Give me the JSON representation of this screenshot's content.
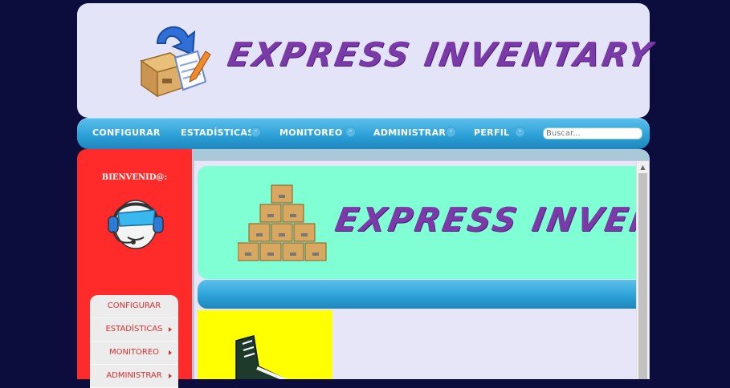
{
  "header": {
    "brand_text": "EXPRESS INVENTARY",
    "logo_icon": "box-with-document-and-arrow-icon"
  },
  "nav": {
    "items": [
      {
        "label": "CONFIGURAR",
        "has_dropdown": false
      },
      {
        "label": "ESTADÍSTICAS",
        "has_dropdown": true
      },
      {
        "label": "MONITOREO",
        "has_dropdown": true
      },
      {
        "label": "ADMINISTRAR",
        "has_dropdown": true
      },
      {
        "label": "PERFIL",
        "has_dropdown": true
      }
    ],
    "dropdown_glyph": "-",
    "search_placeholder": "Buscar..."
  },
  "sidebar": {
    "welcome": "BIENVENID@:",
    "avatar_icon": "support-headset-avatar-icon",
    "menu": [
      {
        "label": "CONFIGURAR",
        "has_submenu": false
      },
      {
        "label": "ESTADÍSTICAS",
        "has_submenu": true
      },
      {
        "label": "MONITOREO",
        "has_submenu": true
      },
      {
        "label": "ADMINISTRAR",
        "has_submenu": true
      }
    ]
  },
  "content": {
    "banner_text": "EXPRESS INVENTARY",
    "banner_icon": "stacked-boxes-pyramid-icon",
    "product_icon": "sneaker-icon"
  },
  "colors": {
    "page_bg": "#0d0d3d",
    "header_bg": "#e4e4f8",
    "nav_blue": "#2a9fd6",
    "sidebar_red": "#ff2b2b",
    "banner_mint": "#80ffd4",
    "product_yellow": "#ffff00",
    "brand_purple": "#7a3aa8"
  }
}
